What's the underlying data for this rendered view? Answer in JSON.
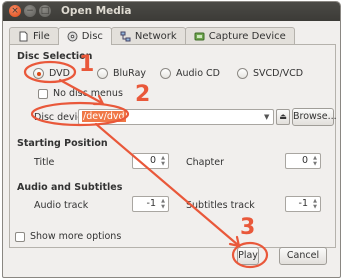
{
  "window": {
    "title": "Open Media",
    "controls": [
      "×",
      "−",
      "□"
    ]
  },
  "tabs": [
    {
      "label": "File",
      "icon": "file-icon",
      "active": false
    },
    {
      "label": "Disc",
      "icon": "disc-icon",
      "active": true
    },
    {
      "label": "Network",
      "icon": "network-icon",
      "active": false
    },
    {
      "label": "Capture Device",
      "icon": "capture-device-icon",
      "active": false
    }
  ],
  "disc_selection": {
    "title": "Disc Selection",
    "options": [
      "DVD",
      "BluRay",
      "Audio CD",
      "SVCD/VCD"
    ],
    "selected": "DVD",
    "no_disc_menus": "No disc menus",
    "disc_device_label": "Disc device",
    "disc_device_value": "/dev/dvd",
    "browse_label": "Browse..."
  },
  "starting_position": {
    "title": "Starting Position",
    "title_label": "Title",
    "title_value": "0",
    "chapter_label": "Chapter",
    "chapter_value": "0"
  },
  "audio_subtitles": {
    "title": "Audio and Subtitles",
    "audio_track_label": "Audio track",
    "audio_track_value": "-1",
    "subtitles_track_label": "Subtitles track",
    "subtitles_track_value": "-1"
  },
  "footer": {
    "show_more_options": "Show more options",
    "play_label": "Play",
    "cancel_label": "Cancel"
  },
  "annotations": {
    "step1": "1",
    "step2": "2",
    "step3": "3",
    "color": "#e9583a"
  }
}
